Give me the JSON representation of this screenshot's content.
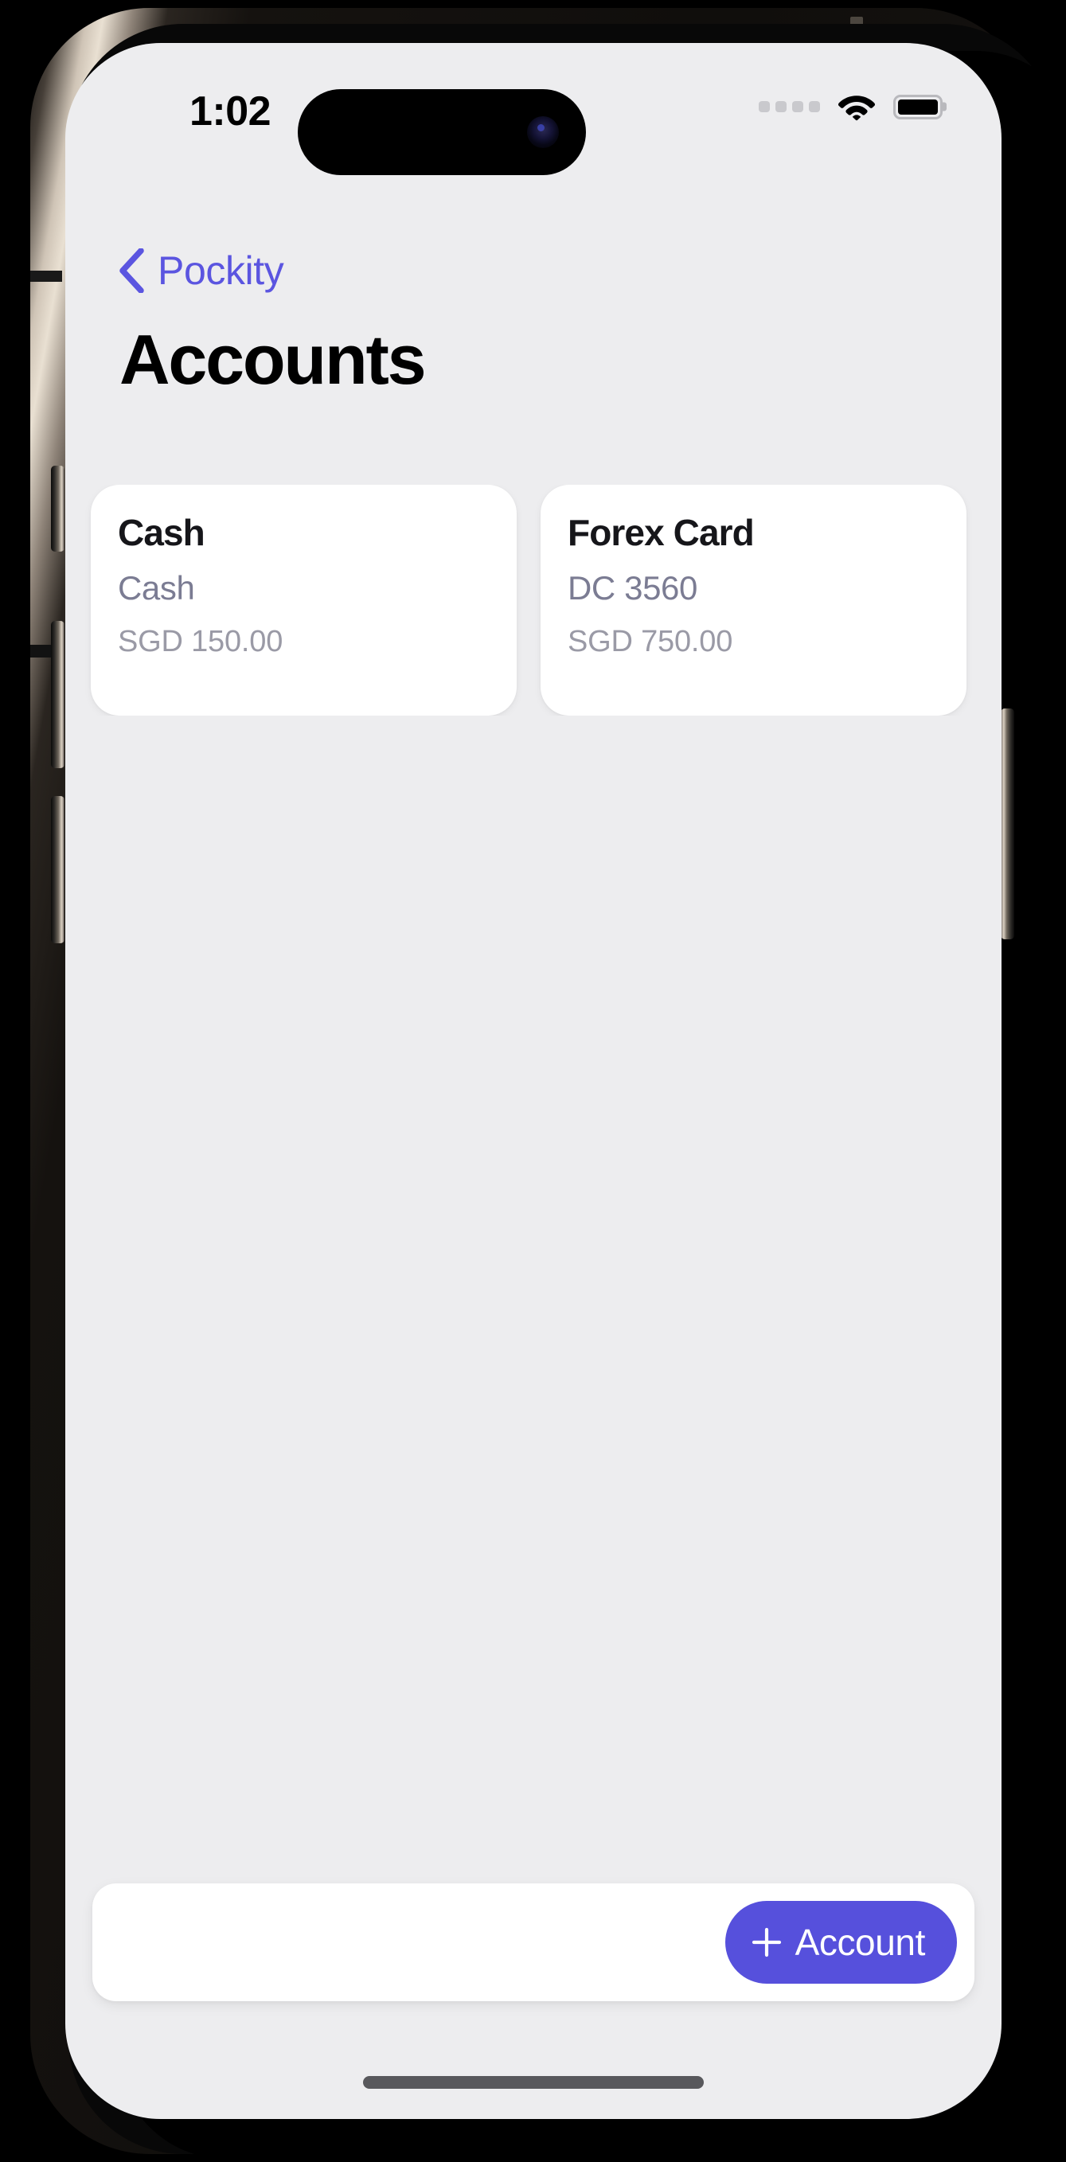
{
  "status_bar": {
    "time": "1:02",
    "cellular_dots": 4,
    "wifi_icon": "wifi-icon",
    "battery_icon": "battery-icon"
  },
  "nav": {
    "back_icon": "chevron-left-icon",
    "back_label": "Pockity"
  },
  "header": {
    "title": "Accounts"
  },
  "accounts": [
    {
      "name": "Cash",
      "subtitle": "Cash",
      "balance": "SGD 150.00"
    },
    {
      "name": "Forex Card",
      "subtitle": "DC 3560",
      "balance": "SGD 750.00"
    }
  ],
  "toolbar": {
    "add_icon": "plus-icon",
    "add_label": "Account"
  },
  "colors": {
    "accent": "#5650dc",
    "screen_background": "#ededef",
    "card_background": "#ffffff",
    "title_text": "#000000",
    "subtitle_text": "#7b7c93",
    "balance_text": "#9a9aa6"
  }
}
